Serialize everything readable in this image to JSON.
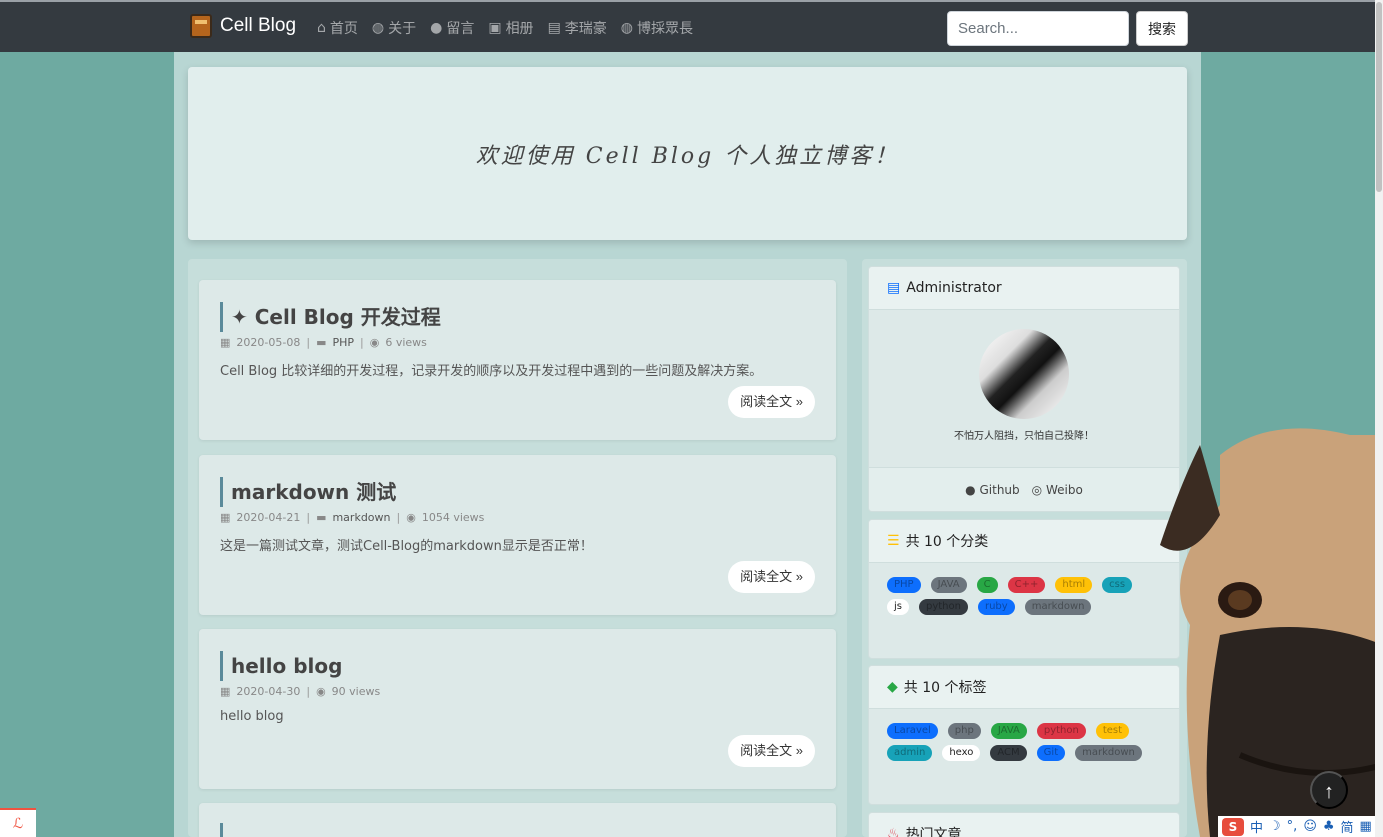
{
  "navbar": {
    "brand": "Cell Blog",
    "links": [
      {
        "icon": "home-icon",
        "glyph": "⌂",
        "label": "首页"
      },
      {
        "icon": "globe-icon",
        "glyph": "◍",
        "label": "关于"
      },
      {
        "icon": "comment-icon",
        "glyph": "●",
        "label": "留言"
      },
      {
        "icon": "image-icon",
        "glyph": "▣",
        "label": "相册"
      },
      {
        "icon": "id-card-icon",
        "glyph": "▤",
        "label": "李瑞豪"
      },
      {
        "icon": "globe-icon",
        "glyph": "◍",
        "label": "博採眾長"
      }
    ],
    "search_placeholder": "Search...",
    "search_button": "搜索"
  },
  "hero": {
    "text": "欢迎使用 Cell Blog 个人独立博客！"
  },
  "posts": [
    {
      "pinned": true,
      "pin_glyph": "✦",
      "title": "Cell Blog 开发过程",
      "date": "2020-05-08",
      "category": "PHP",
      "views": "6 views",
      "excerpt": "Cell Blog 比较详细的开发过程，记录开发的顺序以及开发过程中遇到的一些问题及解决方案。",
      "read_more": "阅读全文 »"
    },
    {
      "pinned": false,
      "title": "markdown 测试",
      "date": "2020-04-21",
      "category": "markdown",
      "views": "1054 views",
      "excerpt": "这是一篇测试文章，测试Cell-Blog的markdown显示是否正常！",
      "read_more": "阅读全文 »"
    },
    {
      "pinned": false,
      "title": "hello blog",
      "date": "2020-04-30",
      "category": "",
      "views": "90 views",
      "excerpt": "hello blog",
      "read_more": "阅读全文 »"
    }
  ],
  "sidebar": {
    "admin": {
      "title": "Administrator",
      "motto": "不怕万人阻挡，只怕自己投降！",
      "github": "Github",
      "weibo": "Weibo"
    },
    "categories": {
      "title": "共 10 个分类",
      "items": [
        {
          "label": "PHP",
          "color": "#0d6efd"
        },
        {
          "label": "JAVA",
          "color": "#6c757d"
        },
        {
          "label": "C",
          "color": "#28a745"
        },
        {
          "label": "C++",
          "color": "#dc3545"
        },
        {
          "label": "html",
          "color": "#ffc107"
        },
        {
          "label": "css",
          "color": "#17a2b8"
        },
        {
          "label": "js",
          "color": "#ffffff"
        },
        {
          "label": "python",
          "color": "#343a40"
        },
        {
          "label": "ruby",
          "color": "#0d6efd"
        },
        {
          "label": "markdown",
          "color": "#6c757d"
        }
      ]
    },
    "tags": {
      "title": "共 10 个标签",
      "items": [
        {
          "label": "Laravel",
          "color": "#0d6efd"
        },
        {
          "label": "php",
          "color": "#6c757d"
        },
        {
          "label": "JAVA",
          "color": "#28a745"
        },
        {
          "label": "python",
          "color": "#dc3545"
        },
        {
          "label": "test",
          "color": "#ffc107"
        },
        {
          "label": "admin",
          "color": "#17a2b8"
        },
        {
          "label": "hexo",
          "color": "#ffffff"
        },
        {
          "label": "ACM",
          "color": "#343a40"
        },
        {
          "label": "Git",
          "color": "#0d6efd"
        },
        {
          "label": "markdown",
          "color": "#6c757d"
        }
      ]
    },
    "hot": {
      "title": "热门文章"
    }
  },
  "ime": {
    "items": [
      "中",
      "☽",
      "°,",
      "☺",
      "♣",
      "简",
      "▦"
    ]
  }
}
